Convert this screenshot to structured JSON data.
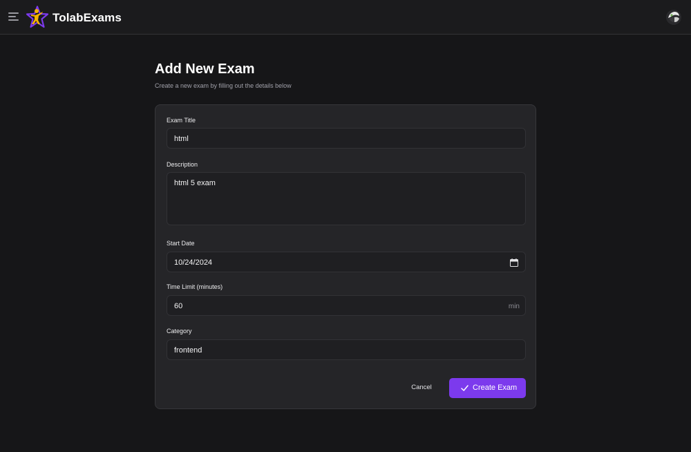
{
  "app": {
    "brand": "TolabExams"
  },
  "page": {
    "title": "Add New Exam",
    "subtitle": "Create a new exam by filling out the details below"
  },
  "form": {
    "exam_title": {
      "label": "Exam Title",
      "value": "html"
    },
    "description": {
      "label": "Description",
      "value": "html 5 exam"
    },
    "start_date": {
      "label": "Start Date",
      "value": "10/24/2024"
    },
    "time_limit": {
      "label": "Time Limit (minutes)",
      "value": "60",
      "suffix": "min"
    },
    "category": {
      "label": "Category",
      "value": "frontend"
    }
  },
  "actions": {
    "cancel_label": "Cancel",
    "create_label": "Create Exam"
  },
  "colors": {
    "accent": "#7c3aed",
    "background": "#161618",
    "card": "#252528"
  },
  "icons": {
    "menu": "hamburger-icon",
    "logo": "star-person-logo",
    "calendar": "calendar-icon",
    "check": "check-icon"
  }
}
